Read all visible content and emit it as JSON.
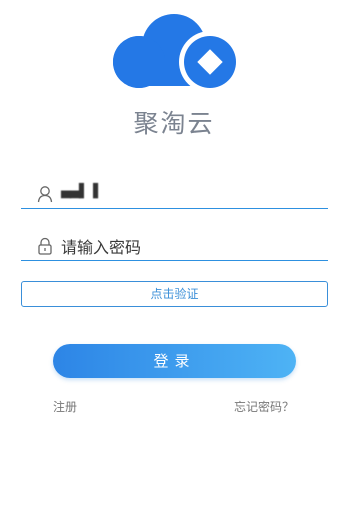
{
  "brand": {
    "name": "聚淘云"
  },
  "form": {
    "username_value": "▄▄▌▐",
    "password_placeholder": "请输入密码",
    "verify_label": "点击验证",
    "login_label": "登录",
    "register_label": "注册",
    "forgot_label": "忘记密码？"
  },
  "colors": {
    "primary": "#2f8be6",
    "primary_light": "#4eb3f5",
    "muted_text": "#7b8390"
  },
  "icons": {
    "logo": "cloud-diamond-logo",
    "user": "user-icon",
    "lock": "lock-icon"
  }
}
